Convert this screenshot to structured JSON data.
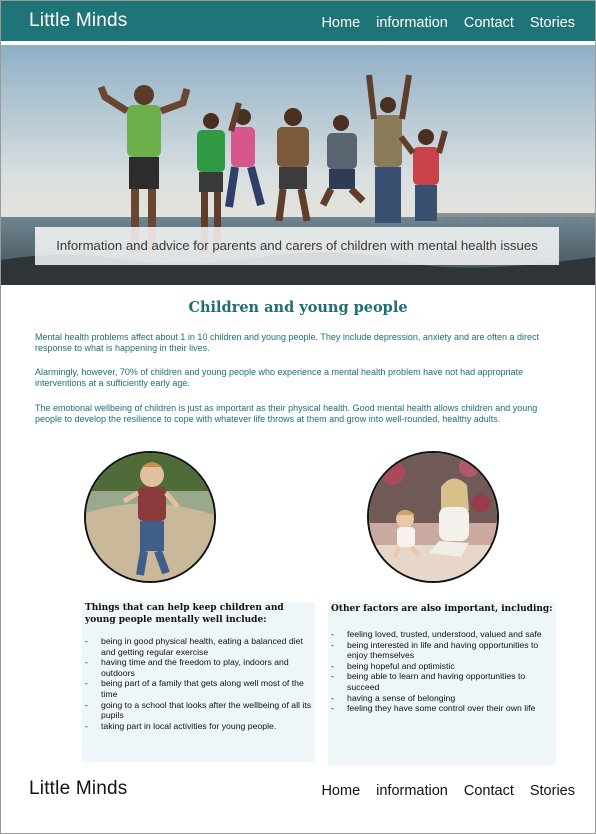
{
  "header": {
    "brand": "Little Minds",
    "nav": [
      "Home",
      "information",
      "Contact",
      "Stories"
    ]
  },
  "hero": {
    "caption": "Information and advice for parents and carers of children with mental health issues"
  },
  "main": {
    "title": "Children and young people",
    "paragraphs": [
      "Mental health problems affect about 1 in 10 children and young people. They include depression, anxiety and are often a direct response to what is happening in their lives.",
      "Alarmingly, however, 70% of children and young people who experience a mental health problem have not had appropriate interventions at a sufficiently early age.",
      "The emotional wellbeing of children is just as important as their physical health. Good mental health allows children and young people to develop the resilience to cope with whatever life throws at them and grow into well-rounded, healthy adults."
    ]
  },
  "box1": {
    "title": "Things that can help keep children and young people mentally well include:",
    "items": [
      "being in good physical health, eating a balanced diet and getting regular exercise",
      "having time and the freedom to play, indoors and outdoors",
      "being part of a family that gets along well most of the time",
      "going to a school that looks after the wellbeing of all its pupils",
      "taking part in local activities for young people."
    ]
  },
  "box2": {
    "title": "Other factors are also important, including:",
    "items": [
      "feeling loved, trusted, understood, valued and safe",
      "being interested in life and having opportunities to enjoy themselves",
      "being hopeful and optimistic",
      "being able to learn and having opportunities to succeed",
      "having a sense of belonging",
      "feeling they have some control over their own life"
    ]
  },
  "footer": {
    "brand": "Little Minds",
    "nav": [
      "Home",
      "information",
      "Contact",
      "Stories"
    ]
  },
  "colors": {
    "header_bg": "#1f7478",
    "accent_text": "#1f6e74",
    "box_bg": "#eef6f9"
  }
}
